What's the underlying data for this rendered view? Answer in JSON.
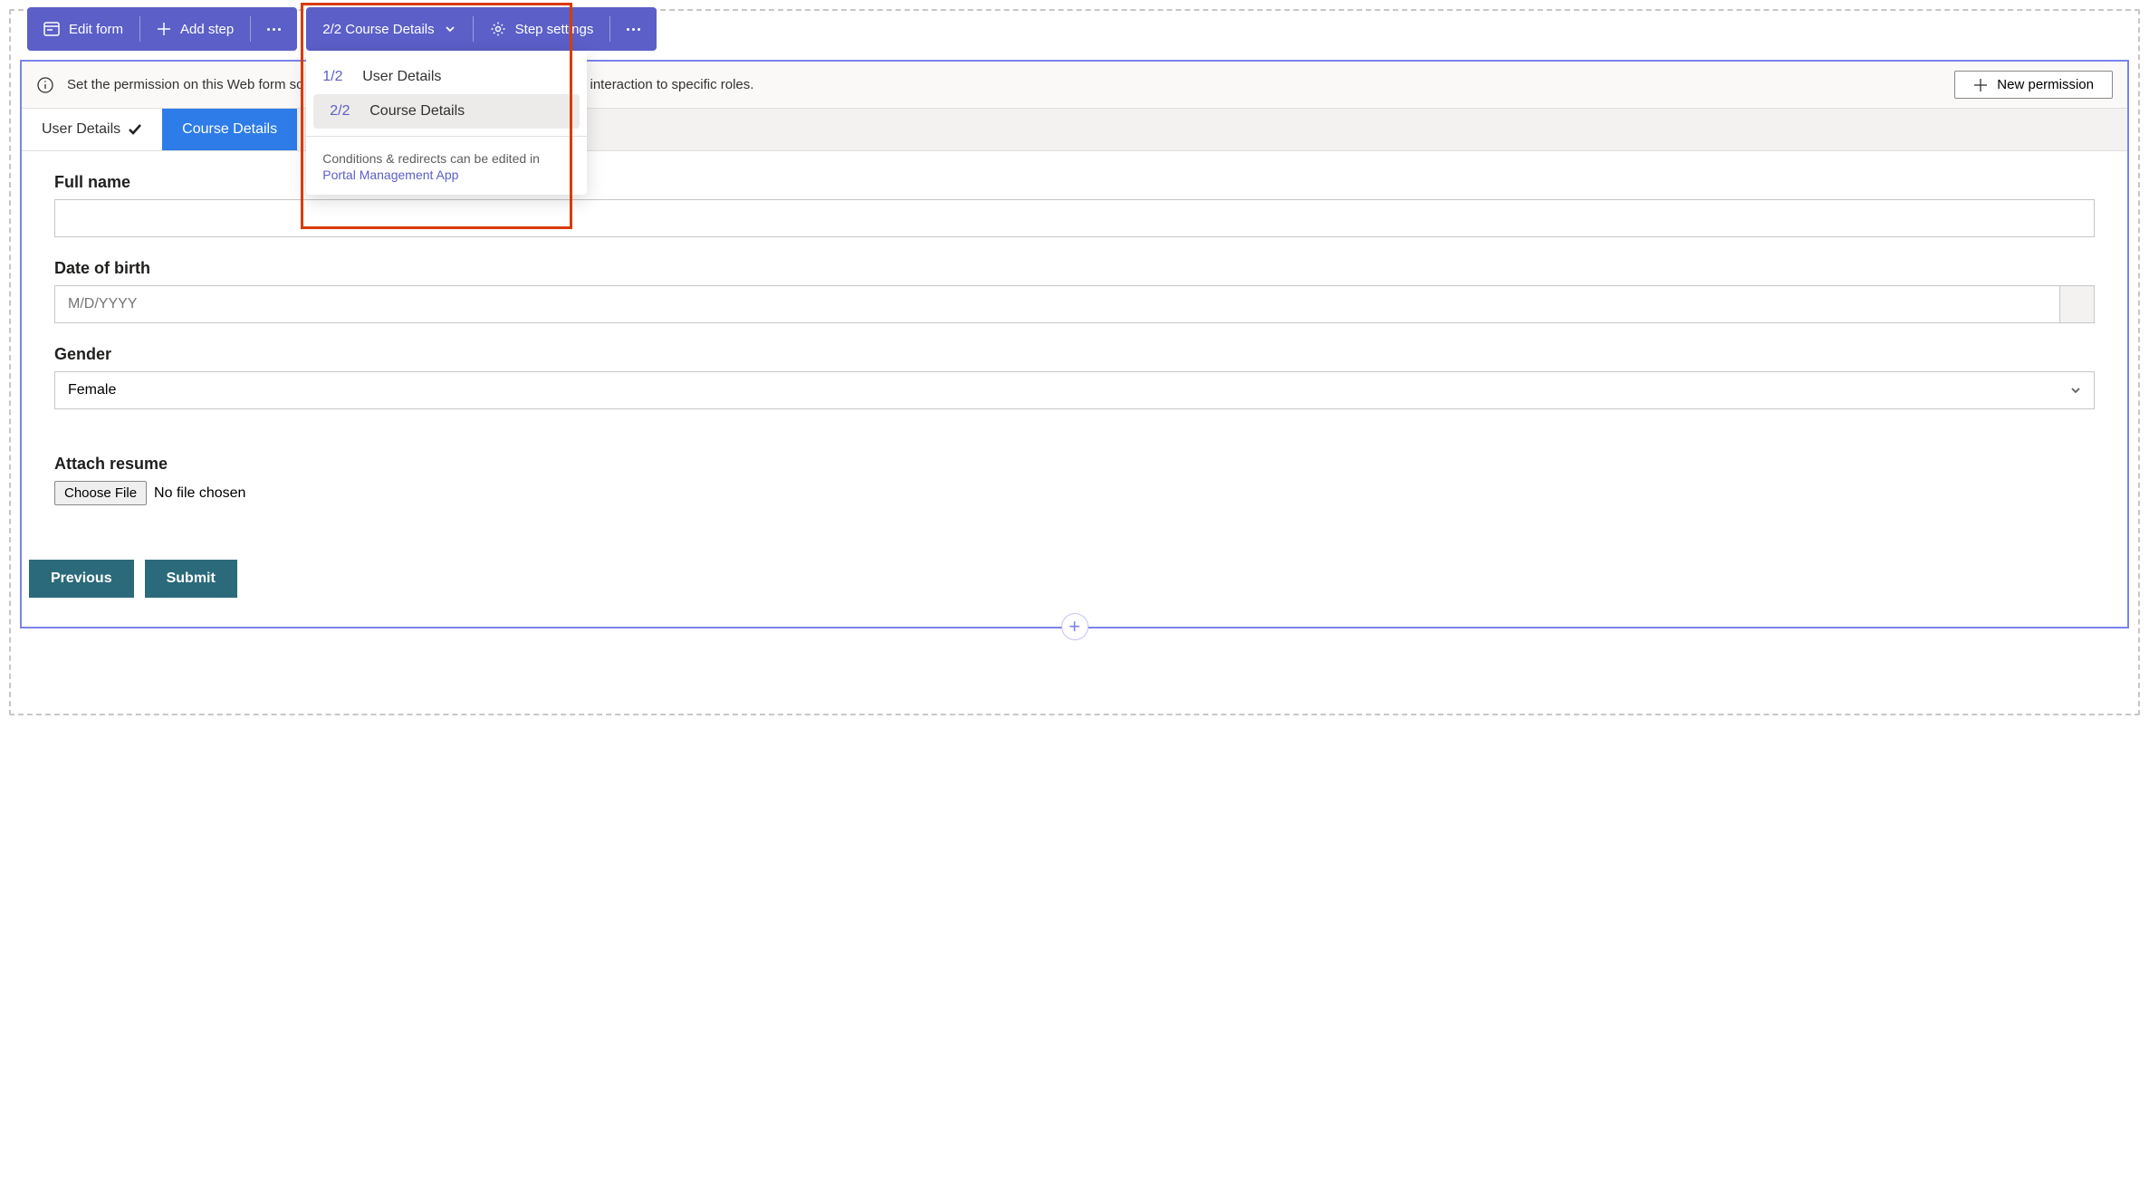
{
  "toolbar1": {
    "edit_form": "Edit form",
    "add_step": "Add step"
  },
  "toolbar2": {
    "step_indicator": "2/2 Course Details",
    "step_settings": "Step settings"
  },
  "dropdown": {
    "items": [
      {
        "idx": "1/2",
        "label": "User Details"
      },
      {
        "idx": "2/2",
        "label": "Course Details"
      }
    ],
    "footer_text": "Conditions & redirects can be edited in",
    "footer_link": "Portal Management App"
  },
  "notice": {
    "text_full": "Set the permission on this Web form so it can either be viewable by anyone or limit the interaction to specific roles.",
    "button": "New permission"
  },
  "tabs": [
    {
      "label": "User Details",
      "state": "completed"
    },
    {
      "label": "Course Details",
      "state": "active"
    }
  ],
  "fields": {
    "full_name": {
      "label": "Full name",
      "value": ""
    },
    "dob": {
      "label": "Date of birth",
      "placeholder": "M/D/YYYY"
    },
    "gender": {
      "label": "Gender",
      "value": "Female"
    },
    "resume": {
      "label": "Attach resume",
      "button": "Choose File",
      "status": "No file chosen"
    }
  },
  "buttons": {
    "previous": "Previous",
    "submit": "Submit"
  }
}
